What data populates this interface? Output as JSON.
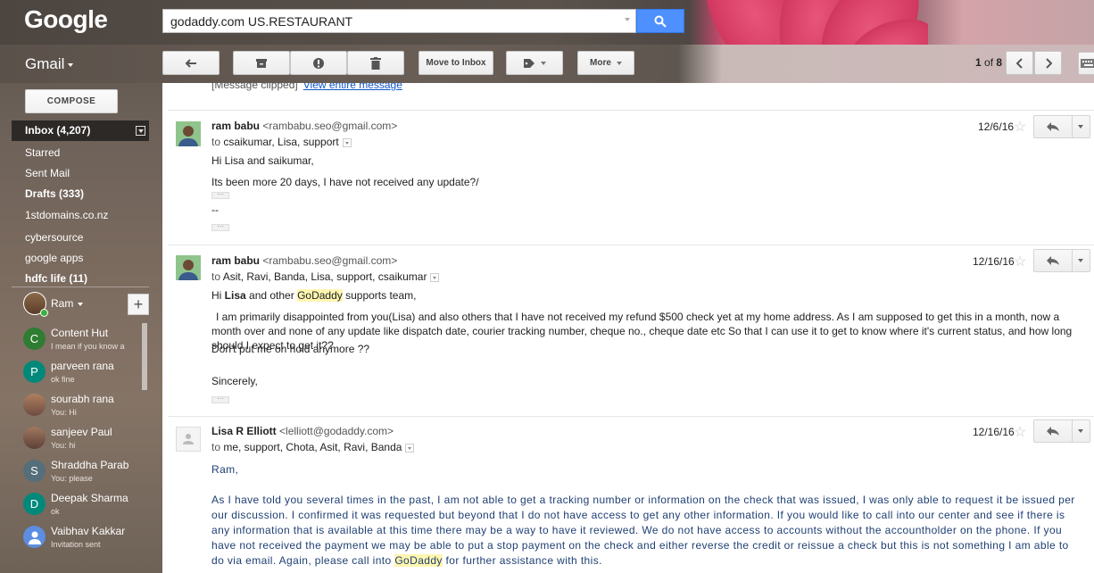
{
  "header": {
    "logo": "Google",
    "search_value": "godaddy.com US.RESTAURANT"
  },
  "toolbar": {
    "app_label": "Gmail",
    "move_to_inbox": "Move to Inbox",
    "more": "More",
    "pager_current": "1",
    "pager_sep": " of ",
    "pager_total": "8"
  },
  "sidebar": {
    "compose": "COMPOSE",
    "inbox": "Inbox (4,207)",
    "items": [
      {
        "label": "Starred"
      },
      {
        "label": "Sent Mail"
      },
      {
        "label": "Drafts (333)"
      },
      {
        "label": "1stdomains.co.nz"
      },
      {
        "label": "cybersource"
      },
      {
        "label": "google apps"
      },
      {
        "label": "hdfc life (11)"
      }
    ],
    "me": "Ram",
    "contacts": [
      {
        "initial": "C",
        "name": "Content Hut",
        "status": "I mean if you know a",
        "color": "#2e7d32"
      },
      {
        "initial": "P",
        "name": "parveen rana",
        "status": "ok fine",
        "color": "#00897b"
      },
      {
        "initial": "",
        "name": "sourabh rana",
        "status": "You: Hi",
        "color": "#8d6e63"
      },
      {
        "initial": "",
        "name": "sanjeev Paul",
        "status": "You: hi",
        "color": "#795548"
      },
      {
        "initial": "S",
        "name": "Shraddha Parab",
        "status": "You: please",
        "color": "#546e7a"
      },
      {
        "initial": "D",
        "name": "Deepak Sharma",
        "status": "ok",
        "color": "#00897b"
      },
      {
        "initial": "",
        "name": "Vaibhav Kakkar",
        "status": "Invitation sent",
        "color": "#5c8de0"
      }
    ]
  },
  "thread": {
    "clipped_text": "[Message clipped]",
    "clipped_link": "View entire message",
    "messages": [
      {
        "sender_name": "ram babu",
        "sender_email": "<rambabu.seo@gmail.com>",
        "to_prefix": "to ",
        "to_names": "csaikumar, Lisa, support",
        "date": "12/6/16",
        "line1": "Hi Lisa and saikumar,",
        "line2": "Its been more 20 days, I have not received any update?/",
        "sig": "--"
      },
      {
        "sender_name": "ram babu",
        "sender_email": "<rambabu.seo@gmail.com>",
        "to_prefix": "to ",
        "to_names": "Asit, Ravi, Banda, Lisa, support, csaikumar",
        "date": "12/16/16",
        "greet_a": "Hi ",
        "greet_b": "Lisa",
        "greet_c": " and other ",
        "greet_d": "GoDaddy",
        "greet_e": " supports team,",
        "para": "I am primarily disappointed from you(Lisa) and also others that I have not received my refund $500 check yet at my home address. As I am supposed to get this in a month, now a month over and none of any update like dispatch date, courier tracking number, cheque no., cheque date etc So that I can use it to get to know where it's current status, and how long should I expect to get it??",
        "line3": "Don't put me on hold anymore ??",
        "closing": "Sincerely,"
      },
      {
        "sender_name": "Lisa R Elliott",
        "sender_email": "<lelliott@godaddy.com>",
        "to_prefix": "to ",
        "to_names": "me, support, Chota, Asit, Ravi, Banda",
        "date": "12/16/16",
        "greet": "Ram,",
        "para_a": "As I have told you several times in the past, I am not able to get a tracking number or information on the check that was issued, I was only able to request it be issued per our discussion. I confirmed it was requested but beyond that I do not have access to get any other information. If you would like to call into our center and see if there is any information that is available at this time there may be a way to have it reviewed. We do not have access to accounts without the accountholder on the phone. If you have not received the payment we may be able to put a stop payment on the check and either reverse the credit or reissue a check but this is not something I am able to do via email. Again, please call into ",
        "para_b": "GoDaddy",
        "para_c": " for further assistance with this."
      }
    ]
  }
}
